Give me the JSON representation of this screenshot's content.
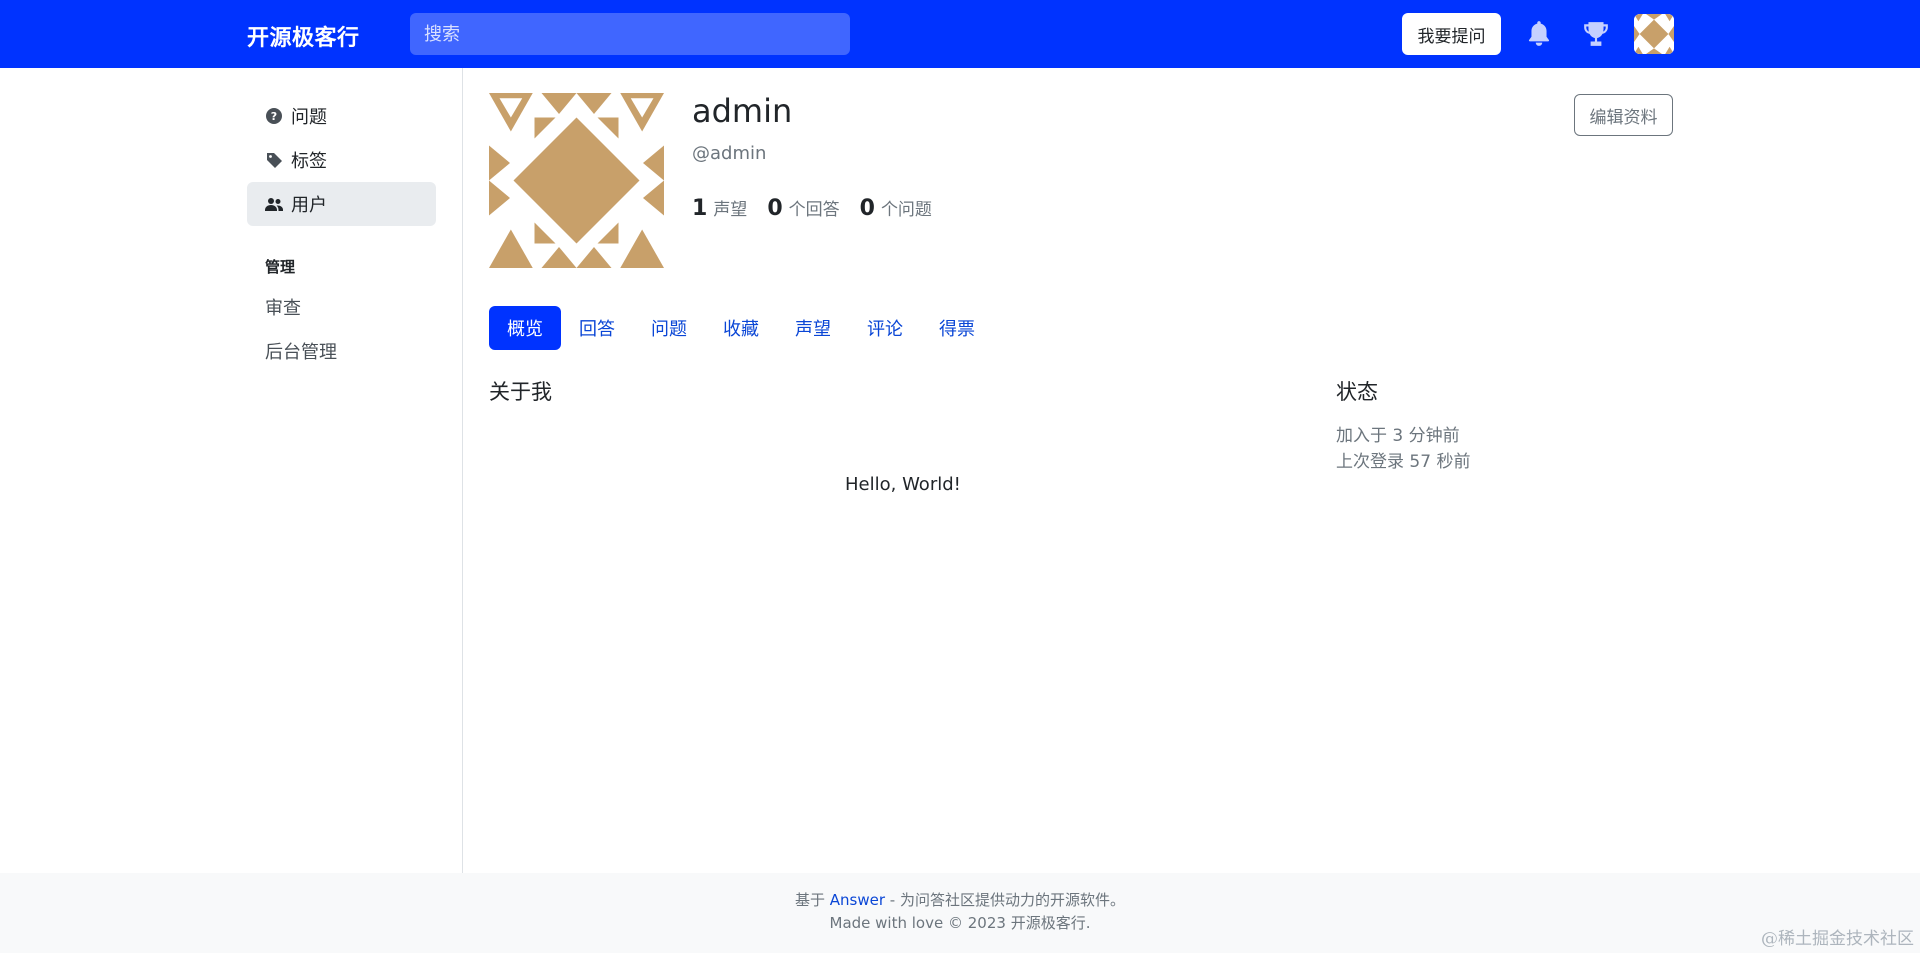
{
  "header": {
    "brand": "开源极客行",
    "search_placeholder": "搜索",
    "ask_button": "我要提问",
    "bell_icon": "bell-icon",
    "trophy_icon": "trophy-icon",
    "brand_color": "#0033ff"
  },
  "sidebar": {
    "items": [
      {
        "label": "问题",
        "icon": "question-circle-icon"
      },
      {
        "label": "标签",
        "icon": "tag-icon"
      },
      {
        "label": "用户",
        "icon": "users-icon",
        "active": true
      }
    ],
    "admin_section_title": "管理",
    "admin_items": [
      {
        "label": "审查"
      },
      {
        "label": "后台管理"
      }
    ]
  },
  "profile": {
    "name": "admin",
    "handle": "@admin",
    "edit_button": "编辑资料",
    "stats": [
      {
        "value": "1",
        "label": "声望"
      },
      {
        "value": "0",
        "label": "个回答"
      },
      {
        "value": "0",
        "label": "个问题"
      }
    ],
    "avatar_color": "#c8a06a"
  },
  "tabs": [
    {
      "label": "概览",
      "active": true
    },
    {
      "label": "回答"
    },
    {
      "label": "问题"
    },
    {
      "label": "收藏"
    },
    {
      "label": "声望"
    },
    {
      "label": "评论"
    },
    {
      "label": "得票"
    }
  ],
  "about": {
    "title": "关于我",
    "body": "Hello, World!"
  },
  "status": {
    "title": "状态",
    "joined": "加入于 3 分钟前",
    "last_login": "上次登录 57 秒前"
  },
  "footer": {
    "line1_prefix": "基于 ",
    "line1_link": "Answer",
    "line1_suffix": " - 为问答社区提供动力的开源软件。",
    "line2": "Made with love © 2023 开源极客行."
  },
  "watermark": "@稀土掘金技术社区"
}
